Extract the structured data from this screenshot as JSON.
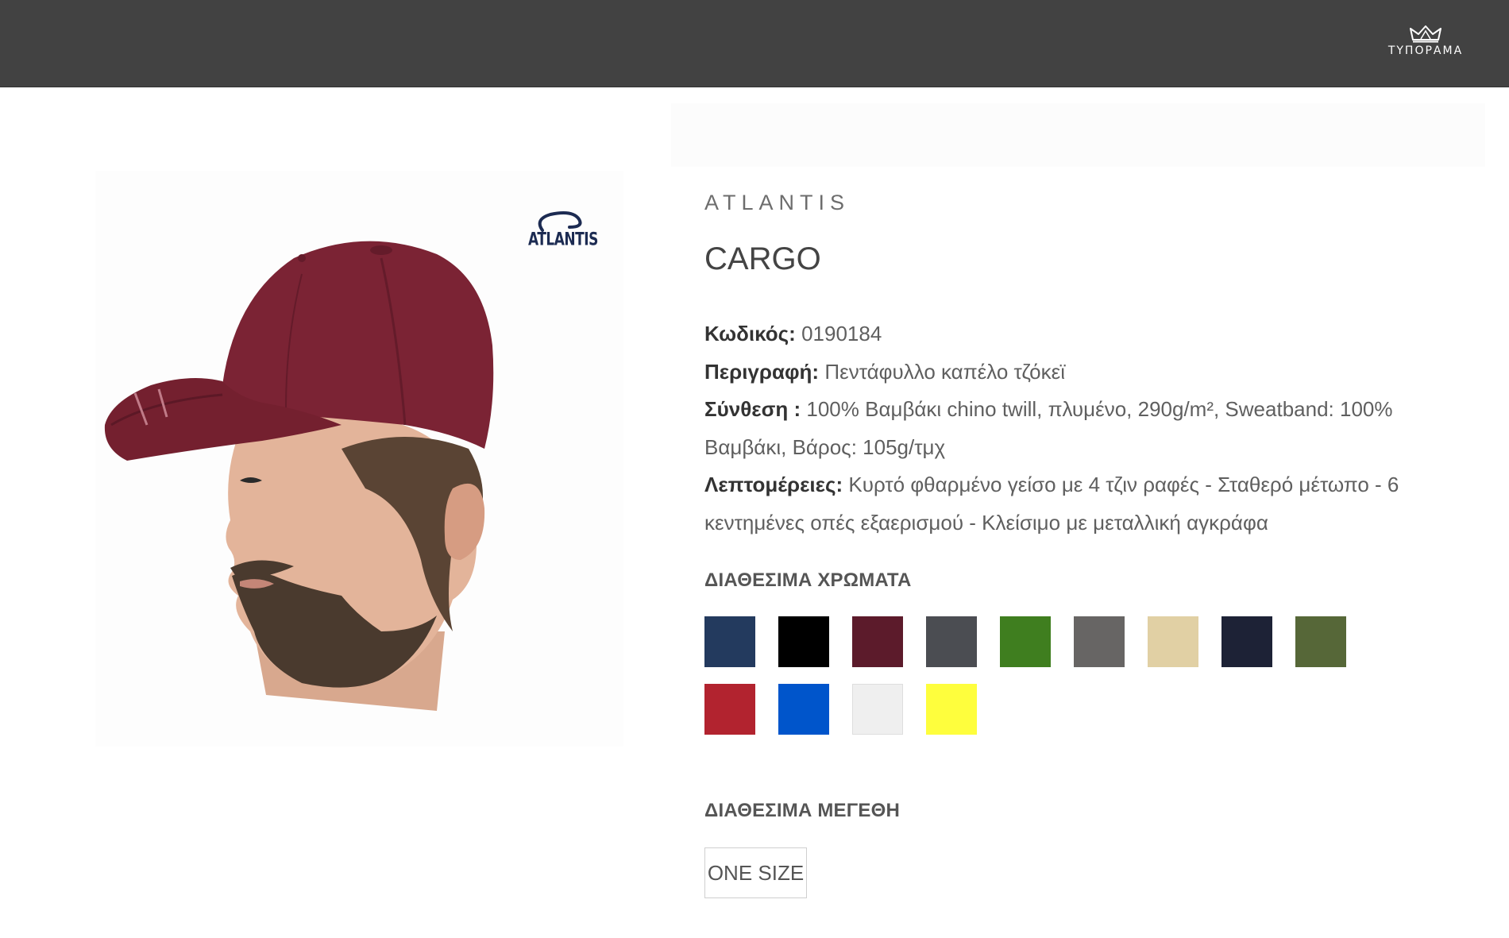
{
  "header": {
    "logo_text": "ΤΥΠΟΡΑΜΑ"
  },
  "product": {
    "image_brand_mark": "ATLANTIS",
    "brand": "ATLANTIS",
    "title": "CARGO",
    "specs": {
      "code_label": "Κωδικός:",
      "code_value": "0190184",
      "description_label": "Περιγραφή:",
      "description_value": "Πεντάφυλλο καπέλο τζόκεϊ",
      "composition_label": "Σύνθεση :",
      "composition_value": "100% Βαμβάκι chino twill, πλυμένο, 290g/m², Sweatband: 100% Βαμβάκι, Βάρος: 105g/τμχ",
      "details_label": "Λεπτομέρειες:",
      "details_value": "Κυρτό φθαρμένο γείσο με 4 τζιν ραφές - Σταθερό μέτωπο - 6 κεντημένες οπές εξαερισμού - Κλείσιμο με μεταλλική αγκράφα"
    }
  },
  "colors": {
    "title": "ΔΙΑΘΕΣΙΜΑ ΧΡΩΜΑΤΑ",
    "swatches": [
      "#233a5e",
      "#000000",
      "#5c1b2b",
      "#4b4d52",
      "#3f7e1f",
      "#676564",
      "#e1d0a4",
      "#1d2236",
      "#566738",
      "#b2232f",
      "#0055cb",
      "#efefef",
      "#fefe3d"
    ]
  },
  "sizes": {
    "title": "ΔΙΑΘΕΣΙΜΑ ΜΕΓΕΘΗ",
    "options": [
      "ONE SIZE"
    ]
  }
}
